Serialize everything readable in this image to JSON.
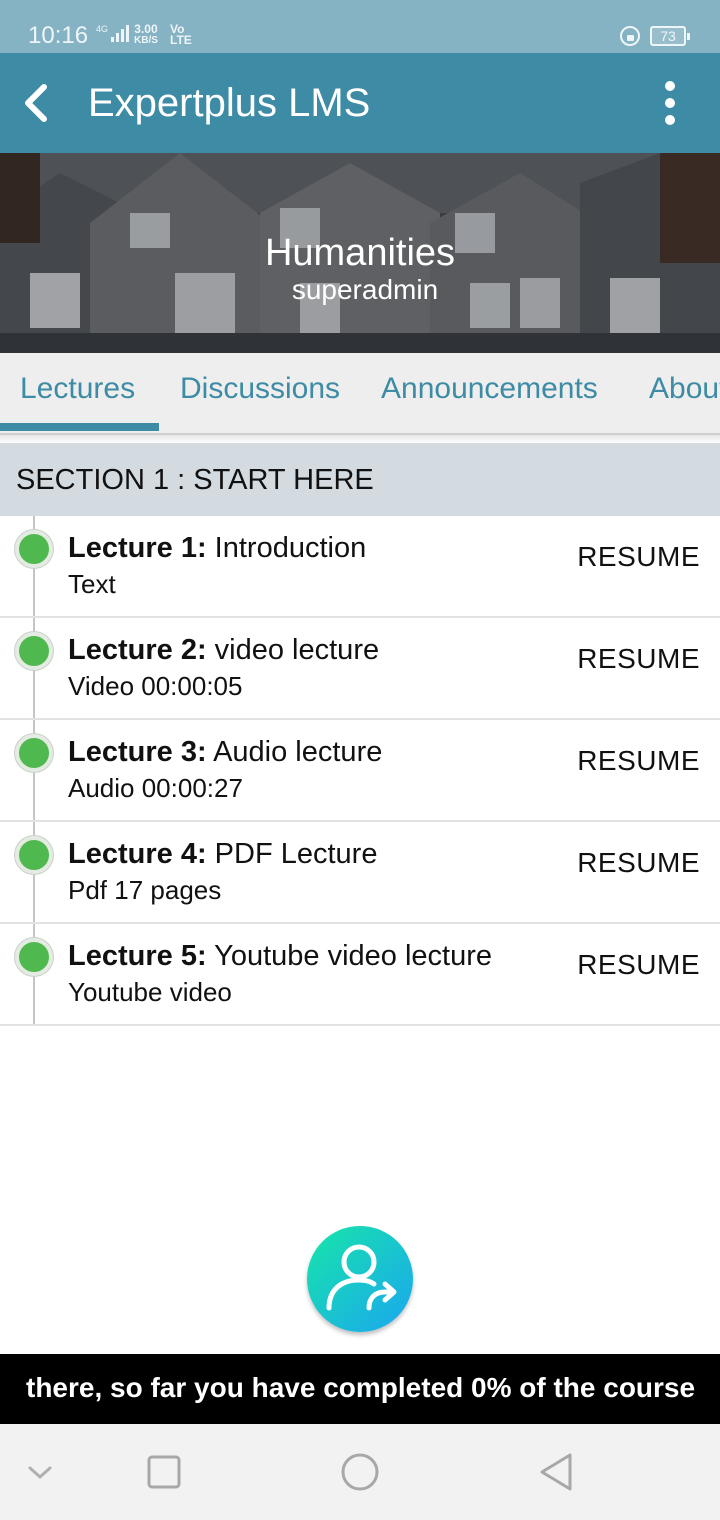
{
  "status_bar": {
    "time": "10:16",
    "network_label": "4G",
    "speed_value": "3.00",
    "speed_unit": "KB/S",
    "lte_top": "Vo",
    "lte_bottom": "LTE",
    "battery": "73"
  },
  "app_bar": {
    "title": "Expertplus LMS",
    "back_icon": "chevron-left-icon",
    "menu_icon": "more-vertical-icon",
    "color": "#3d8ba5"
  },
  "course": {
    "title": "Humanities",
    "author": "superadmin"
  },
  "tabs": [
    {
      "label": "Lectures",
      "selected": true
    },
    {
      "label": "Discussions",
      "selected": false
    },
    {
      "label": "Announcements",
      "selected": false
    },
    {
      "label": "About",
      "selected": false
    }
  ],
  "section": {
    "title": "SECTION 1 : START HERE"
  },
  "lectures": [
    {
      "number": "Lecture 1:",
      "name": "Introduction",
      "detail": "Text",
      "action": "RESUME",
      "status_color": "#4fb950"
    },
    {
      "number": "Lecture 2:",
      "name": "video lecture",
      "detail": "Video 00:00:05",
      "action": "RESUME",
      "status_color": "#4fb950"
    },
    {
      "number": "Lecture 3:",
      "name": "Audio lecture",
      "detail": "Audio 00:00:27",
      "action": "RESUME",
      "status_color": "#4fb950"
    },
    {
      "number": "Lecture 4:",
      "name": "PDF Lecture",
      "detail": "Pdf 17 pages",
      "action": "RESUME",
      "status_color": "#4fb950"
    },
    {
      "number": "Lecture 5:",
      "name": "Youtube video lecture",
      "detail": "Youtube video",
      "action": "RESUME",
      "status_color": "#4fb950"
    }
  ],
  "fab": {
    "icon": "share-user-icon"
  },
  "ticker": {
    "text": "there, so far you have completed 0% of the course"
  },
  "nav_bar": {
    "icons": [
      "chevron-down-icon",
      "square-icon",
      "circle-icon",
      "triangle-back-icon"
    ]
  }
}
